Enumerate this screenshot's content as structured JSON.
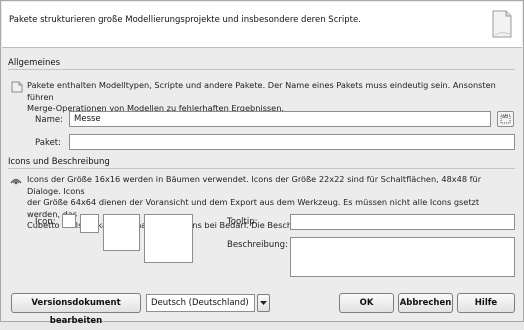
{
  "header": {
    "description": "Pakete strukturieren große Modellierungsprojekte und insbesondere deren Scripte.",
    "icon": "document-icon"
  },
  "general": {
    "title": "Allgemeines",
    "description_line1": "Pakete enthalten Modelltypen, Scripte und andere Pakete. Der Name eines Pakets muss eindeutig sein. Ansonsten führen",
    "description_line2": "Merge-Operationen von Modellen zu fehlerhaften Ergebnissen.",
    "name_label": "Name:",
    "name_value": "Messe",
    "package_label": "Paket:",
    "package_value": ""
  },
  "icons": {
    "title": "Icons und Beschreibung",
    "description_line1": "Icons der Größe 16x16 werden in Bäumen verwendet. Icons der Größe 22x22 sind für Schaltflächen, 48x48 für Dialoge. Icons",
    "description_line2": "der Größe 64x64 dienen der Voransicht und dem Export aus dem Werkzeug. Es müssen nicht alle Icons gsetzt werden, das",
    "description_line3": "Cubetto Toolset skaliert benachbarte Icons bei Bedarf. Die Beschreibungen werden in den Dialogen angezeigt.",
    "icon_label": "Icon:",
    "tooltip_label": "Tooltip:",
    "tooltip_value": "",
    "description_label": "Beschreibung:",
    "description_value": ""
  },
  "footer": {
    "version_button": "Versionsdokument bearbeiten",
    "language_selected": "Deutsch (Deutschland)",
    "ok_button": "OK",
    "cancel_button": "Abbrechen",
    "help_button": "Hilfe"
  }
}
